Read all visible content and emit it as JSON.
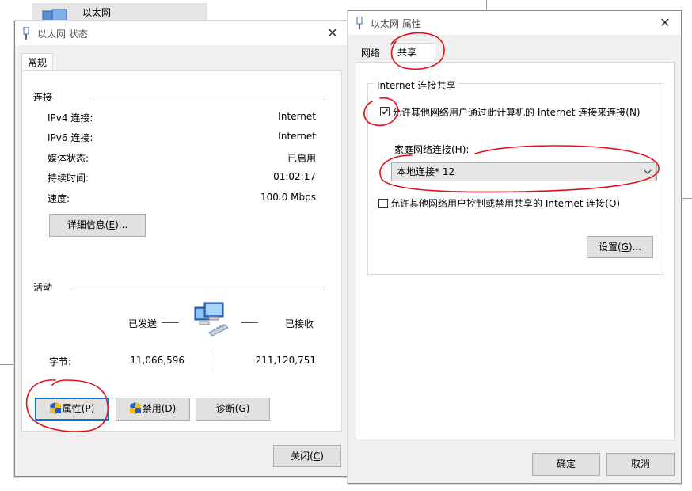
{
  "background": {
    "explorer_item_label": "以太网"
  },
  "status_window": {
    "title": "以太网 状态",
    "tabs": [
      "常规"
    ],
    "connection_group": "连接",
    "rows": [
      {
        "label": "IPv4 连接:",
        "value": "Internet"
      },
      {
        "label": "IPv6 连接:",
        "value": "Internet"
      },
      {
        "label": "媒体状态:",
        "value": "已启用"
      },
      {
        "label": "持续时间:",
        "value": "01:02:17"
      },
      {
        "label": "速度:",
        "value": "100.0 Mbps"
      }
    ],
    "details_button": {
      "text": "详细信息(",
      "key": "E",
      "suffix": ")..."
    },
    "activity_group": "活动",
    "sent_label": "已发送",
    "received_label": "已接收",
    "bytes_label": "字节:",
    "bytes_sent": "11,066,596",
    "bytes_received": "211,120,751",
    "properties_button": {
      "text": "属性(",
      "key": "P",
      "suffix": ")"
    },
    "disable_button": {
      "text": "禁用(",
      "key": "D",
      "suffix": ")"
    },
    "diagnose_button": {
      "text": "诊断(",
      "key": "G",
      "suffix": ")"
    },
    "close_button": {
      "text": "关闭(",
      "key": "C",
      "suffix": ")"
    }
  },
  "properties_window": {
    "title": "以太网 属性",
    "tabs": [
      "网络",
      "共享"
    ],
    "sharing_group": "Internet 连接共享",
    "allow_share_checkbox": {
      "label": "允许其他网络用户通过此计算机的 Internet 连接来连接(N)",
      "checked": true
    },
    "home_network_label": "家庭网络连接(H):",
    "home_network_selected": "本地连接* 12",
    "allow_control_checkbox": {
      "label": "允许其他网络用户控制或禁用共享的 Internet 连接(O)",
      "checked": false
    },
    "settings_button": {
      "text": "设置(",
      "key": "G",
      "suffix": ")..."
    },
    "ok_button": "确定",
    "cancel_button": "取消"
  },
  "colors": {
    "annotation": "#e0101c",
    "focus": "#0078d7",
    "dialog_bg": "#f0f0f0"
  }
}
